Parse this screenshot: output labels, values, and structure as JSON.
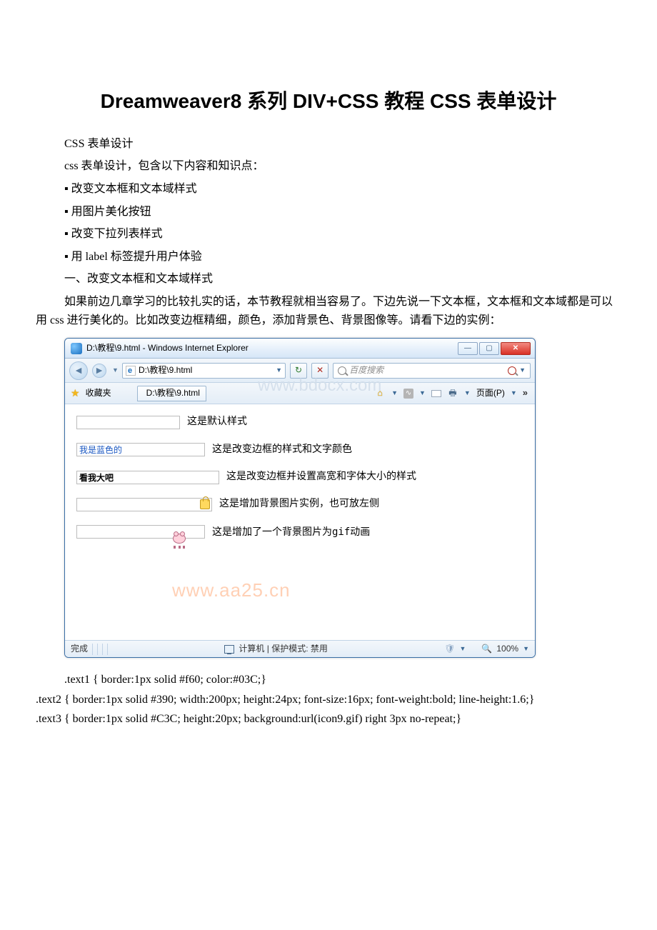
{
  "title": "Dreamweaver8 系列 DIV+CSS 教程 CSS 表单设计",
  "para1": "CSS 表单设计",
  "para2": "css 表单设计，包含以下内容和知识点：",
  "bullets": {
    "b1": "▪ 改变文本框和文本域样式",
    "b2": "▪ 用图片美化按钮",
    "b3": "▪ 改变下拉列表样式",
    "b4": "▪ 用 label 标签提升用户体验"
  },
  "section1": "一、改变文本框和文本域样式",
  "intro": "如果前边几章学习的比较扎实的话，本节教程就相当容易了。下边先说一下文本框，文本框和文本域都是可以用 css 进行美化的。比如改变边框精细，颜色，添加背景色、背景图像等。请看下边的实例：",
  "ie": {
    "titlebar": "D:\\教程\\9.html - Windows Internet Explorer",
    "addr": "D:\\教程\\9.html",
    "searchPlaceholder": "百度搜索",
    "favLabel": "收藏夹",
    "tabTitle": "D:\\教程\\9.html",
    "pageMenu": "页面(P)",
    "rows": {
      "r1": {
        "value": "",
        "label": "这是默认样式"
      },
      "r2": {
        "value": "我是蓝色的",
        "label": "这是改变边框的样式和文字颜色"
      },
      "r3": {
        "value": "看我大吧",
        "label": "这是改变边框并设置高宽和字体大小的样式"
      },
      "r4": {
        "value": "",
        "label": "这是增加背景图片实例，也可放左侧"
      },
      "r5": {
        "value": "",
        "label": "这是增加了一个背景图片为gif动画"
      }
    },
    "status": {
      "done": "完成",
      "zone": "计算机 | 保护模式: 禁用",
      "zoom": "100%"
    },
    "watermark1": "www.bdocx.com",
    "watermark2": "www.aa25.cn"
  },
  "code": {
    "c1": ".text1 { border:1px solid #f60; color:#03C;}",
    "c2": ".text2 { border:1px solid #390; width:200px; height:24px; font-size:16px; font-weight:bold; line-height:1.6;}",
    "c3": ".text3 { border:1px solid #C3C; height:20px; background:url(icon9.gif) right 3px no-repeat;}"
  }
}
